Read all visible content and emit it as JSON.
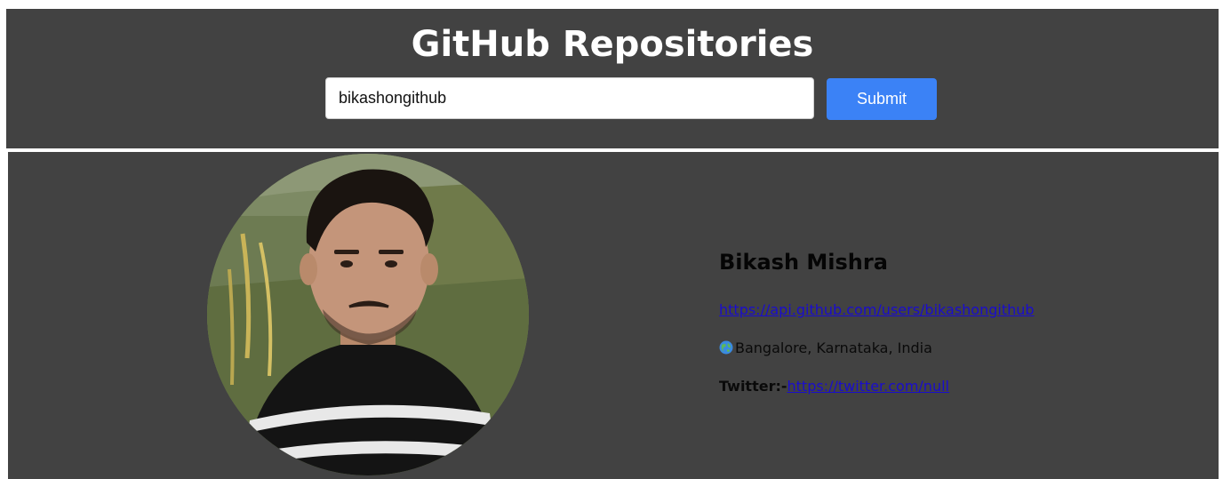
{
  "header": {
    "title": "GitHub Repositories",
    "search": {
      "value": "bikashongithub",
      "placeholder": ""
    },
    "submit_label": "Submit"
  },
  "profile": {
    "name": "Bikash Mishra",
    "api_url": "https://api.github.com/users/bikashongithub",
    "location_icon": "globe-icon",
    "location": "Bangalore, Karnataka, India",
    "twitter_label": "Twitter:-",
    "twitter_url": "https://twitter.com/null"
  },
  "colors": {
    "panel_background": "#424242",
    "submit_button": "#3b82f6",
    "link": "#1a0dcc"
  }
}
